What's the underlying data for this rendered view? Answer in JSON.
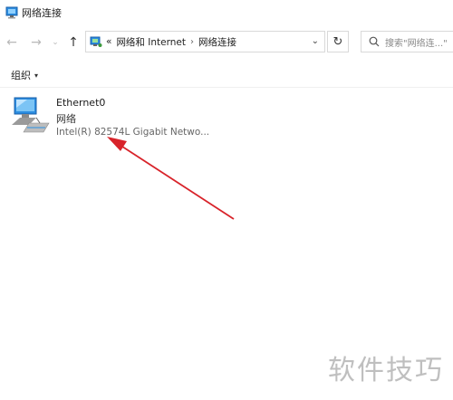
{
  "window": {
    "title": "网络连接"
  },
  "nav": {
    "back_glyph": "←",
    "forward_glyph": "→",
    "up_glyph": "↑"
  },
  "address": {
    "chevrons": "«",
    "crumb1": "网络和 Internet",
    "sep": "›",
    "crumb2": "网络连接",
    "dropdown_glyph": "⌄"
  },
  "refresh_glyph": "↻",
  "search": {
    "placeholder": "搜索\"网络连...\""
  },
  "toolbar": {
    "organize_label": "组织",
    "caret": "▾"
  },
  "connection": {
    "name": "Ethernet0",
    "type": "网络",
    "device": "Intel(R) 82574L Gigabit Netwo..."
  },
  "watermark": "软件技巧",
  "colors": {
    "arrow": "#d8232a",
    "monitor_blue": "#2c8de0"
  }
}
